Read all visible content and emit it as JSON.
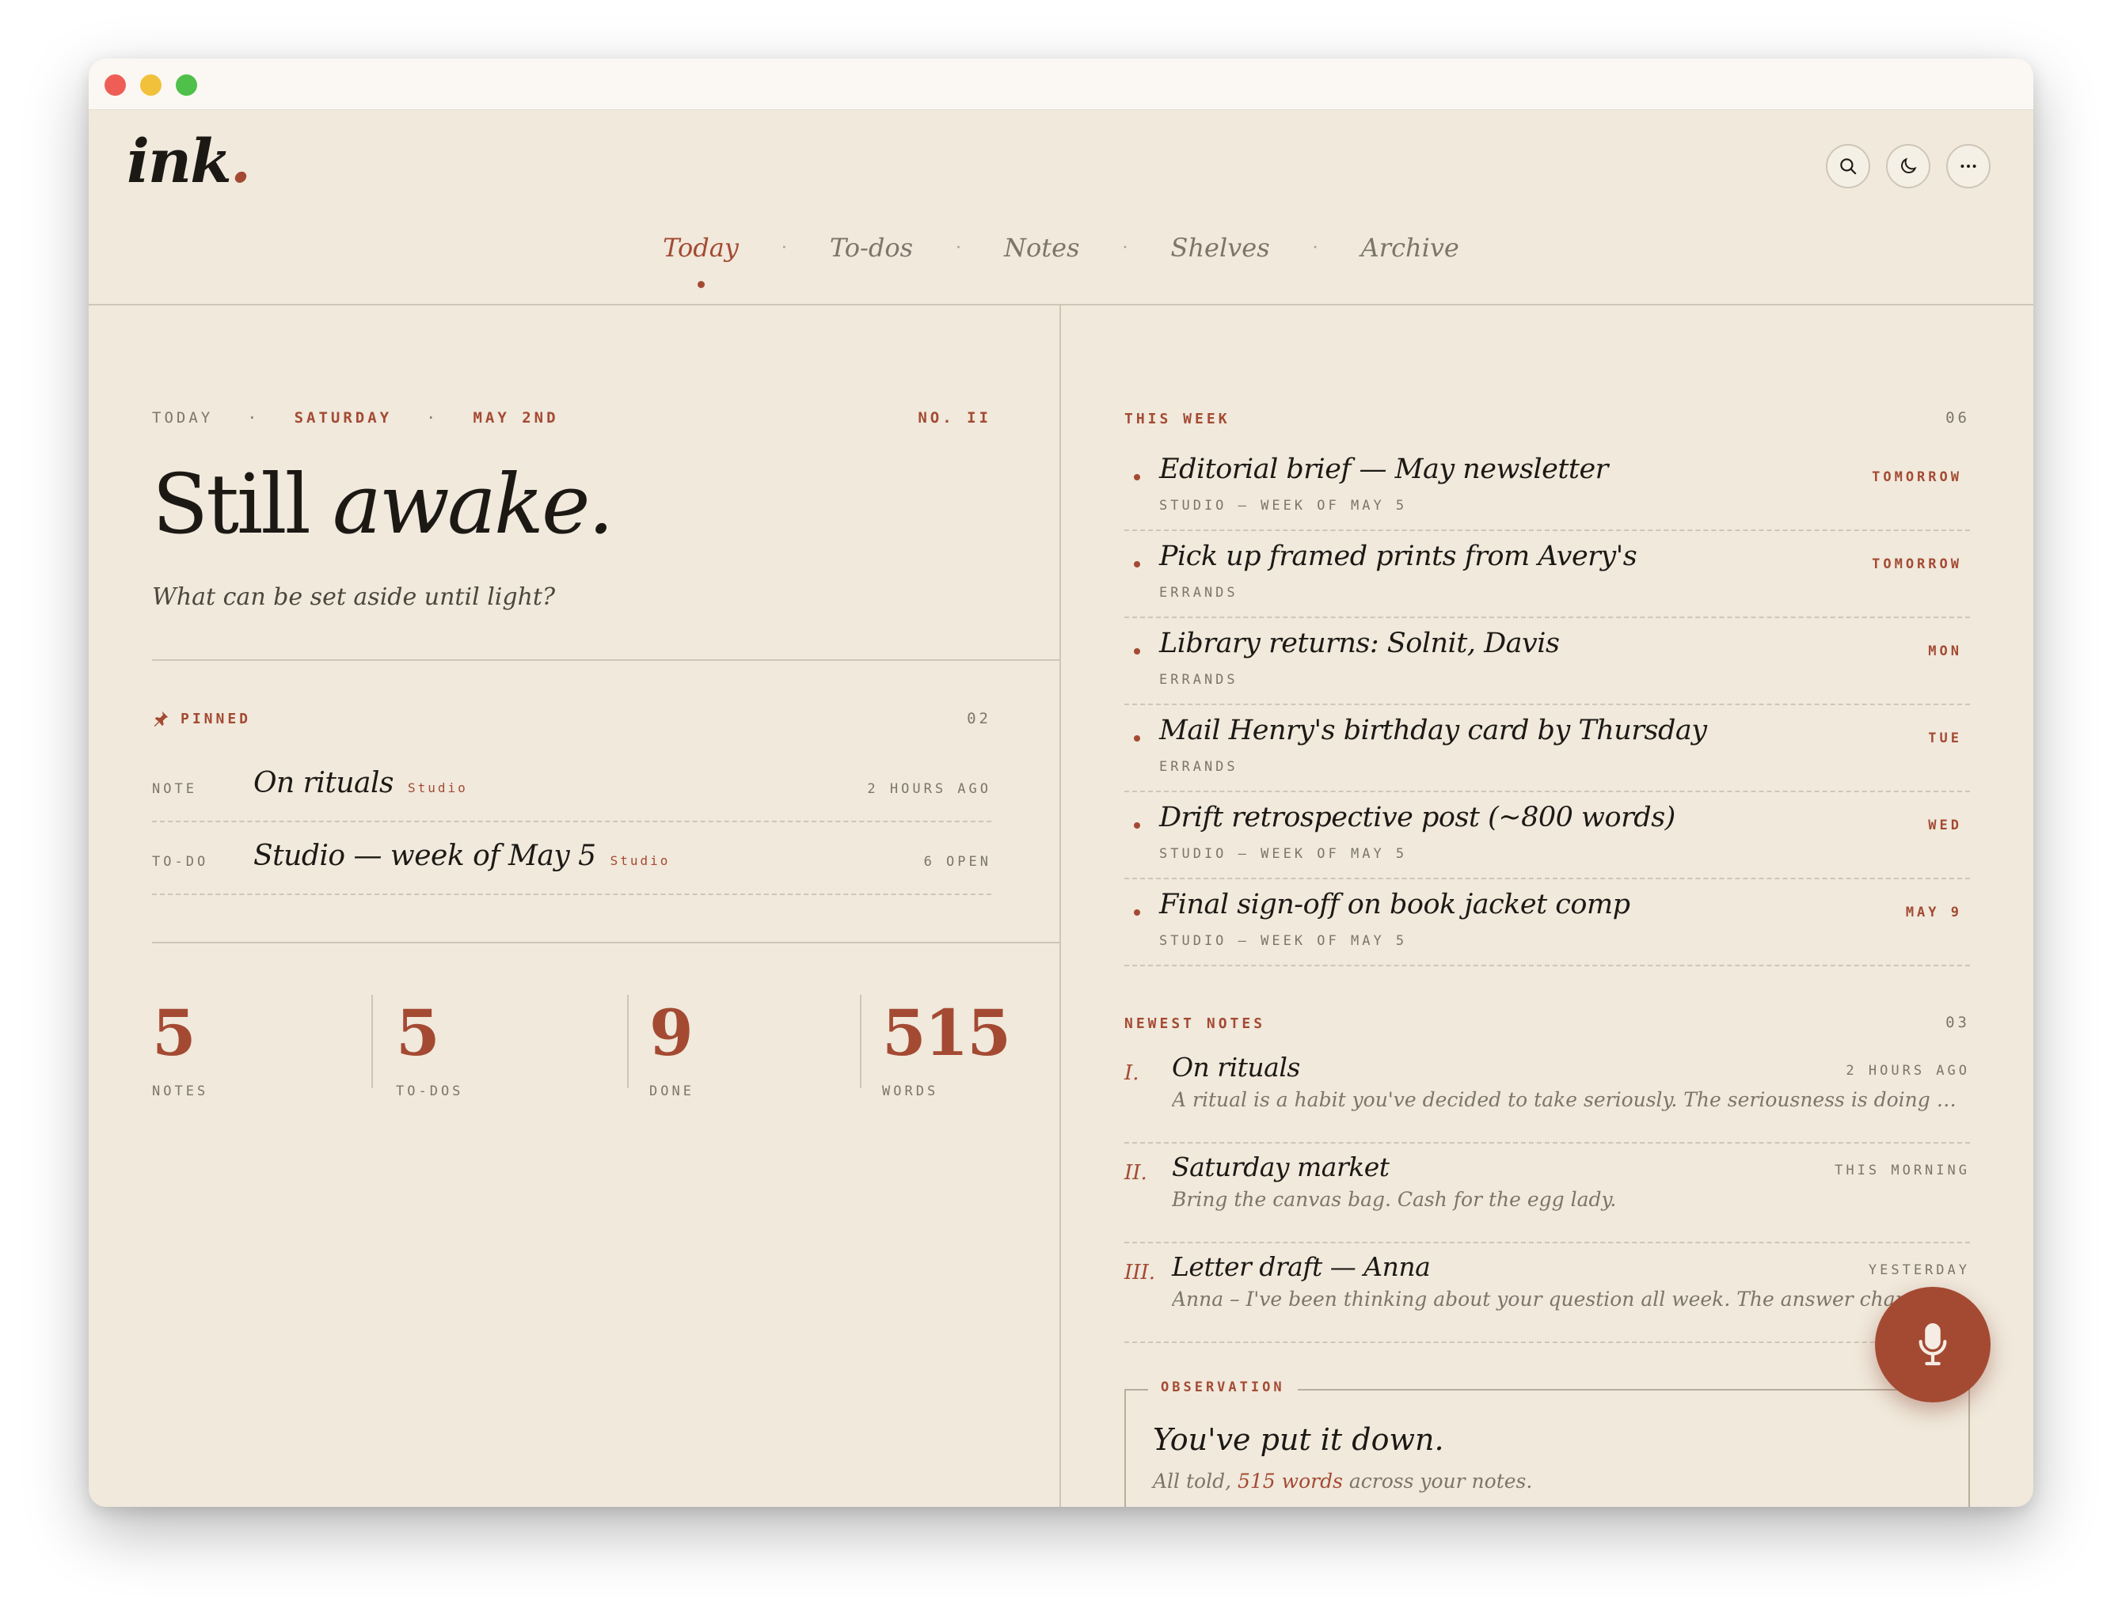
{
  "app": {
    "logo_text": "ink",
    "logo_dot": "."
  },
  "header": {
    "icons": [
      "search-icon",
      "moon-icon",
      "more-icon"
    ]
  },
  "nav": {
    "items": [
      {
        "label": "Today",
        "active": true
      },
      {
        "label": "To-dos"
      },
      {
        "label": "Notes"
      },
      {
        "label": "Shelves"
      },
      {
        "label": "Archive"
      }
    ],
    "separator": "·"
  },
  "today": {
    "date_parts": [
      "Today",
      "·",
      "Saturday",
      "·",
      "May 2nd"
    ],
    "issue": "No. II",
    "headline_plain": "Still",
    "headline_italic": "awake.",
    "subhead": "What can be set aside until light?"
  },
  "pinned": {
    "label": "Pinned",
    "count": "02",
    "items": [
      {
        "kind": "Note",
        "title": "On rituals",
        "tag": "Studio",
        "meta": "2 hours ago"
      },
      {
        "kind": "To-do",
        "title": "Studio — week of May 5",
        "tag": "Studio",
        "meta": "6 open"
      }
    ]
  },
  "stats": [
    {
      "value": "5",
      "label": "Notes"
    },
    {
      "value": "5",
      "label": "To-dos"
    },
    {
      "value": "9",
      "label": "Done"
    },
    {
      "value": "515",
      "label": "Words"
    }
  ],
  "this_week": {
    "label": "This week",
    "count": "06",
    "items": [
      {
        "title": "Editorial brief — May newsletter",
        "sub": "Studio — Week of May 5",
        "when": "Tomorrow"
      },
      {
        "title": "Pick up framed prints from Avery's",
        "sub": "Errands",
        "when": "Tomorrow"
      },
      {
        "title": "Library returns: Solnit, Davis",
        "sub": "Errands",
        "when": "Mon"
      },
      {
        "title": "Mail Henry's birthday card by Thursday",
        "sub": "Errands",
        "when": "Tue"
      },
      {
        "title": "Drift retrospective post (~800 words)",
        "sub": "Studio — Week of May 5",
        "when": "Wed"
      },
      {
        "title": "Final sign-off on book jacket comp",
        "sub": "Studio — Week of May 5",
        "when": "May 9"
      }
    ]
  },
  "newest_notes": {
    "label": "Newest notes",
    "count": "03",
    "items": [
      {
        "num": "I.",
        "title": "On rituals",
        "when": "2 hours ago",
        "excerpt": "A ritual is a habit you've decided to take seriously. The seriousness is doing most of the work here, and I keep coming back to it."
      },
      {
        "num": "II.",
        "title": "Saturday market",
        "when": "This morning",
        "excerpt": "Bring the canvas bag. Cash for the egg lady."
      },
      {
        "num": "III.",
        "title": "Letter draft — Anna",
        "when": "Yesterday",
        "excerpt": "Anna – I've been thinking about your question all week. The answer changes depending on the hour I ask it."
      }
    ]
  },
  "observation": {
    "label": "Observation",
    "title": "You've put it down.",
    "text_before": "All told,",
    "highlight": "515 words",
    "text_after": "across your notes."
  },
  "fab": {
    "icon": "microphone-icon"
  },
  "colors": {
    "accent": "#a44a33",
    "paper": "#f0e9dc",
    "ink": "#1c1915",
    "muted": "#7d756a"
  }
}
